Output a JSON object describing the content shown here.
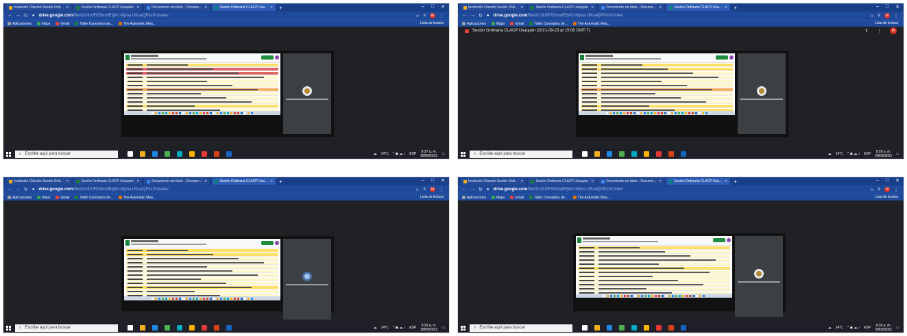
{
  "screens": [
    {
      "tabs": [
        {
          "label": "Invitación Citación Sesión Ordi...",
          "color": "#f2b01e"
        },
        {
          "label": "Sesión Ordinaria CLACP Usaquén",
          "color": "#188038"
        },
        {
          "label": "Documento sin título - Docume...",
          "color": "#4285f4"
        },
        {
          "label": "Sesión Ordinaria CLACP Usa...",
          "color": "#00897b",
          "active": true
        }
      ],
      "url_host": "drive.google.com",
      "url_path": "/file/d/1rlU0Fl0Sns8EfyKc-Mpna UKuaQPN-Pm/view",
      "show_meet_title": false,
      "clock_time": "9:27 a. m.",
      "clock_date": "28/09/2021",
      "participant_avatar": "dog"
    },
    {
      "tabs": [
        {
          "label": "Invitación Citación Sesión Ordi...",
          "color": "#f2b01e"
        },
        {
          "label": "Sesión Ordinaria CLACP Usaquén",
          "color": "#188038"
        },
        {
          "label": "Documento sin título - Docume...",
          "color": "#4285f4"
        },
        {
          "label": "Sesión Ordinaria CLACP Usa...",
          "color": "#00897b",
          "active": true
        }
      ],
      "url_host": "drive.google.com",
      "url_path": "/file/d/1rlU0Fl0Sns8EfyKc-Mpna UKuaQPN-Pm/view",
      "show_meet_title": true,
      "clock_time": "9:28 a. m.",
      "clock_date": "28/09/2021",
      "participant_avatar": "dog"
    },
    {
      "tabs": [
        {
          "label": "Invitación Citación Sesión Ordi...",
          "color": "#f2b01e"
        },
        {
          "label": "Sesión Ordinaria CLACP Usaquén",
          "color": "#188038"
        },
        {
          "label": "Documento sin título - Docume...",
          "color": "#4285f4"
        },
        {
          "label": "Sesión Ordinaria CLACP Usa...",
          "color": "#00897b",
          "active": true
        }
      ],
      "url_host": "drive.google.com",
      "url_path": "/file/d/1rlU0Fl0Sns8EfyKc-Mpna UKuaQPN-Pm/view",
      "show_meet_title": false,
      "clock_time": "9:29 a. m.",
      "clock_date": "28/09/2021",
      "participant_avatar": "blue"
    },
    {
      "tabs": [
        {
          "label": "Invitación Citación Sesión Ordi...",
          "color": "#f2b01e"
        },
        {
          "label": "Sesión Ordinaria CLACP Usaquén",
          "color": "#188038"
        },
        {
          "label": "Documento sin título - Docume...",
          "color": "#4285f4"
        },
        {
          "label": "Sesión Ordinaria CLACP Usa...",
          "color": "#00897b",
          "active": true
        }
      ],
      "url_host": "drive.google.com",
      "url_path": "/file/d/1rlU0Fl0Sns8EfyKc-Mpna UKuaQPN-Pm/view",
      "show_meet_title": false,
      "clock_time": "9:30 a. m.",
      "clock_date": "28/09/2021",
      "participant_avatar": "dog"
    }
  ],
  "bookmarks": [
    {
      "label": "Aplicaciones",
      "color": "#9aa0a6"
    },
    {
      "label": "Maps",
      "color": "#34a853"
    },
    {
      "label": "Gmail",
      "color": "#ea4335"
    },
    {
      "label": "Taller Conceptos de...",
      "color": "#188038"
    },
    {
      "label": "The Automatic Mea...",
      "color": "#e37400"
    }
  ],
  "reading_list": "Lista de lectura",
  "meet_title": "Sesión Ordinaria CLACP Usaquén (2021-09-23 at 15:08 GMT-7)",
  "profile_initial": "M",
  "search_placeholder": "Escribe aquí para buscar",
  "weather": "14°C",
  "language": "ESP",
  "taskbar_icon_colors": [
    "#ffffff",
    "#f2b01e",
    "#1e88e5",
    "#4caf50",
    "#00acc1",
    "#ffb300",
    "#e53935",
    "#d84315",
    "#1565c0"
  ]
}
